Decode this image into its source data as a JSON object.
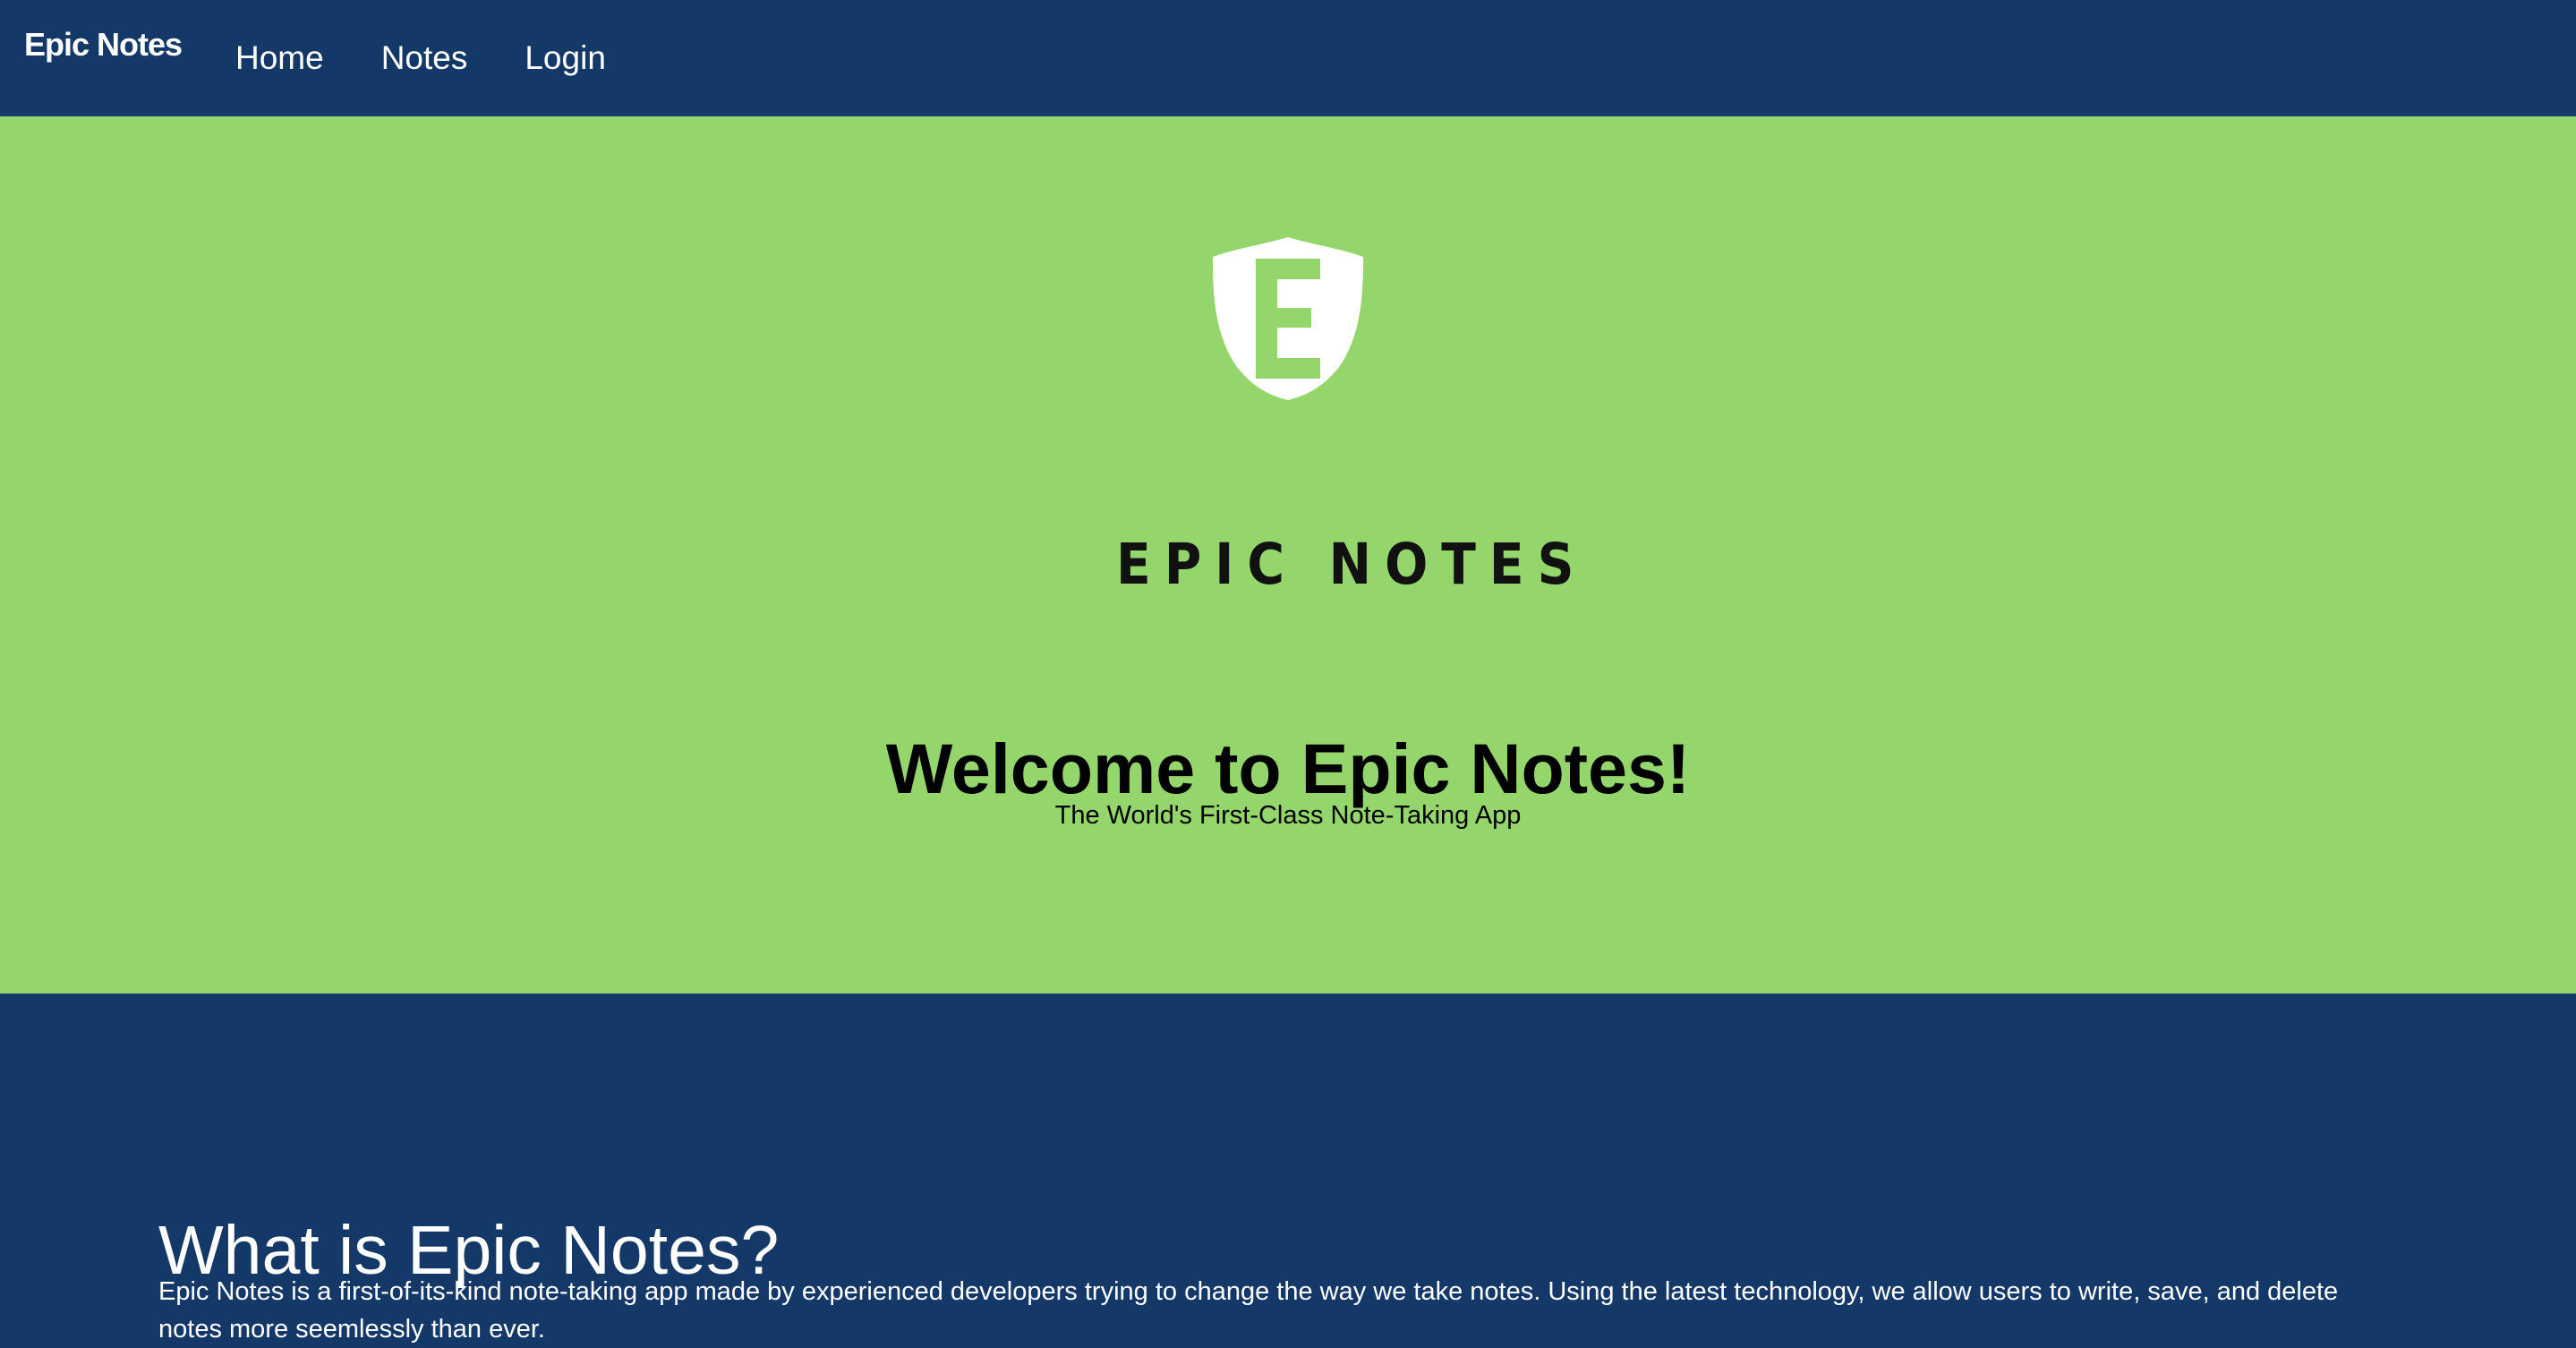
{
  "navbar": {
    "brand": "Epic Notes",
    "links": [
      {
        "label": "Home"
      },
      {
        "label": "Notes"
      },
      {
        "label": "Login"
      }
    ]
  },
  "hero": {
    "logo": {
      "letter": "E",
      "wordmark": "EPIC NOTES"
    },
    "title": "Welcome to Epic Notes!",
    "subtitle": "The World's First-Class Note-Taking App"
  },
  "about": {
    "title": "What is Epic Notes?",
    "text": "Epic Notes is a first-of-its-kind note-taking app made by experienced developers trying to change the way we take notes. Using the latest technology, we allow users to write, save, and delete notes more seemlessly than ever."
  },
  "colors": {
    "navy": "#143867",
    "green": "#94d66b",
    "white": "#ffffff",
    "black": "#000000"
  }
}
